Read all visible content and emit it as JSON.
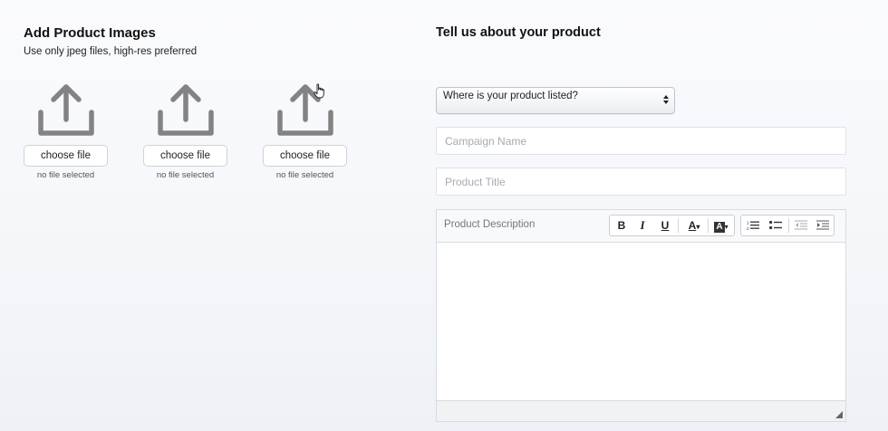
{
  "images_section": {
    "title": "Add Product Images",
    "subtitle": "Use only jpeg files, high-res preferred",
    "uploaders": [
      {
        "button_label": "choose file",
        "status": "no file selected"
      },
      {
        "button_label": "choose file",
        "status": "no file selected"
      },
      {
        "button_label": "choose file",
        "status": "no file selected"
      }
    ],
    "icon": "upload-icon"
  },
  "product_section": {
    "title": "Tell us about your product",
    "listing_select": {
      "selected": "Where is your product listed?"
    },
    "campaign_name": {
      "placeholder": "Campaign Name",
      "value": ""
    },
    "product_title": {
      "placeholder": "Product Title",
      "value": ""
    },
    "description_editor": {
      "label": "Product Description",
      "toolbar": {
        "bold": "B",
        "italic": "I",
        "underline": "U",
        "font_color": "A",
        "highlight": "A",
        "icons": [
          "bold-icon",
          "italic-icon",
          "underline-icon",
          "font-color-icon",
          "highlight-color-icon",
          "ordered-list-icon",
          "unordered-list-icon",
          "outdent-icon",
          "indent-icon"
        ]
      },
      "value": ""
    }
  },
  "colors": {
    "icon_gray": "#838383",
    "border": "#d7dbe0",
    "placeholder": "#a6abb2"
  }
}
